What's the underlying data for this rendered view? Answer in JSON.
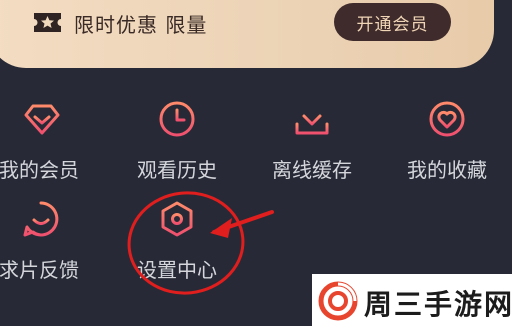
{
  "banner": {
    "icon": "star-ticket-icon",
    "text": "限时优惠 限量",
    "vip_button": "开通会员"
  },
  "menu": {
    "row1": [
      {
        "label": "我的会员",
        "icon": "diamond-icon"
      },
      {
        "label": "观看历史",
        "icon": "clock-icon"
      },
      {
        "label": "离线缓存",
        "icon": "download-icon"
      },
      {
        "label": "我的收藏",
        "icon": "heart-icon"
      }
    ],
    "row2": [
      {
        "label": "求片反馈",
        "icon": "smile-chat-icon"
      },
      {
        "label": "设置中心",
        "icon": "hexagon-settings-icon"
      }
    ]
  },
  "watermark": {
    "text": "周三手游网"
  },
  "colors": {
    "background": "#272a36",
    "icon_gradient_start": "#ff8a6b",
    "icon_gradient_end": "#f0506e",
    "annotation": "#e01e1e"
  }
}
